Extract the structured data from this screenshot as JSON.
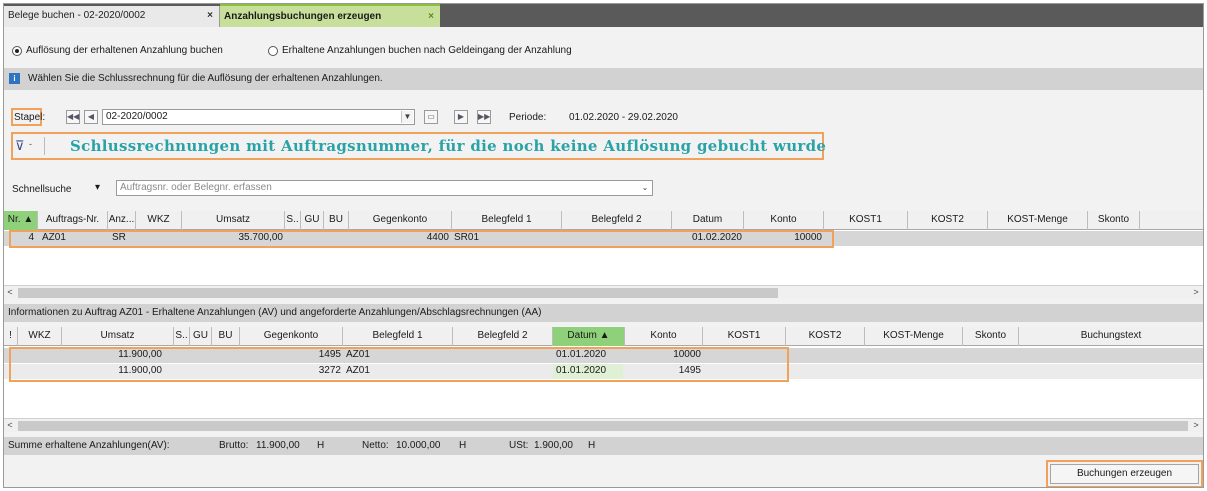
{
  "tabs": [
    {
      "label": "Belege buchen  - 02-2020/0002",
      "close": "×"
    },
    {
      "label": "Anzahlungsbuchungen erzeugen",
      "close": "×"
    }
  ],
  "mode": {
    "option1": "Auflösung der erhaltenen Anzahlung buchen",
    "option2": "Erhaltene Anzahlungen buchen nach Geldeingang der Anzahlung",
    "selected": "option1"
  },
  "info_message": "Wählen Sie die Schlussrechnung für die Auflösung der erhaltenen Anzahlungen.",
  "stapel": {
    "label": "Stapel:",
    "value": "02-2020/0002",
    "periode_label": "Periode:",
    "periode_value": "01.02.2020 - 29.02.2020"
  },
  "filter": {
    "caption": "Schlussrechnungen mit Auftragsnummer, für die noch keine Auflösung gebucht wurde"
  },
  "schnellsuche": {
    "label": "Schnellsuche",
    "placeholder": "Auftragsnr. oder Belegnr. erfassen"
  },
  "grid1": {
    "headers": [
      "Nr.",
      "Auftrags-Nr.",
      "Anz...",
      "WKZ",
      "Umsatz",
      "S..",
      "GU",
      "BU",
      "Gegenkonto",
      "Belegfeld 1",
      "Belegfeld 2",
      "Datum",
      "Konto",
      "KOST1",
      "KOST2",
      "KOST-Menge",
      "Skonto"
    ],
    "rows": [
      {
        "nr": "4",
        "auftrag": "AZ01",
        "anz": "SR",
        "wkz": "",
        "umsatz": "35.700,00",
        "s": "",
        "gu": "",
        "bu": "",
        "gegenkonto": "4400",
        "belegfeld1": "SR01",
        "belegfeld2": "",
        "datum": "01.02.2020",
        "konto": "10000",
        "kost1": "",
        "kost2": "",
        "kostmenge": "",
        "skonto": ""
      }
    ]
  },
  "section2_title": "Informationen zu Auftrag AZ01 - Erhaltene Anzahlungen (AV) und angeforderte Anzahlungen/Abschlagsrechnungen (AA)",
  "grid2": {
    "headers": [
      "!",
      "WKZ",
      "Umsatz",
      "S..",
      "GU",
      "BU",
      "Gegenkonto",
      "Belegfeld 1",
      "Belegfeld 2",
      "Datum",
      "Konto",
      "KOST1",
      "KOST2",
      "KOST-Menge",
      "Skonto",
      "Buchungstext"
    ],
    "rows": [
      {
        "umsatz": "11.900,00",
        "gegenkonto": "1495",
        "belegfeld1": "AZ01",
        "datum": "01.01.2020",
        "konto": "10000"
      },
      {
        "umsatz": "11.900,00",
        "gegenkonto": "3272",
        "belegfeld1": "AZ01",
        "datum": "01.01.2020",
        "konto": "1495"
      }
    ]
  },
  "summary": {
    "label": "Summe erhaltene Anzahlungen(AV):",
    "brutto_label": "Brutto:",
    "brutto_value": "11.900,00",
    "brutto_unit": "H",
    "netto_label": "Netto:",
    "netto_value": "10.000,00",
    "netto_unit": "H",
    "ust_label": "USt:",
    "ust_value": "1.900,00",
    "ust_unit": "H"
  },
  "button": {
    "label": "Buchungen erzeugen"
  },
  "colors": {
    "accent_tab": "#c7df9a",
    "highlight": "#f0a25a",
    "caption": "#2aa3a8",
    "sorted_column": "#8fd17a"
  }
}
